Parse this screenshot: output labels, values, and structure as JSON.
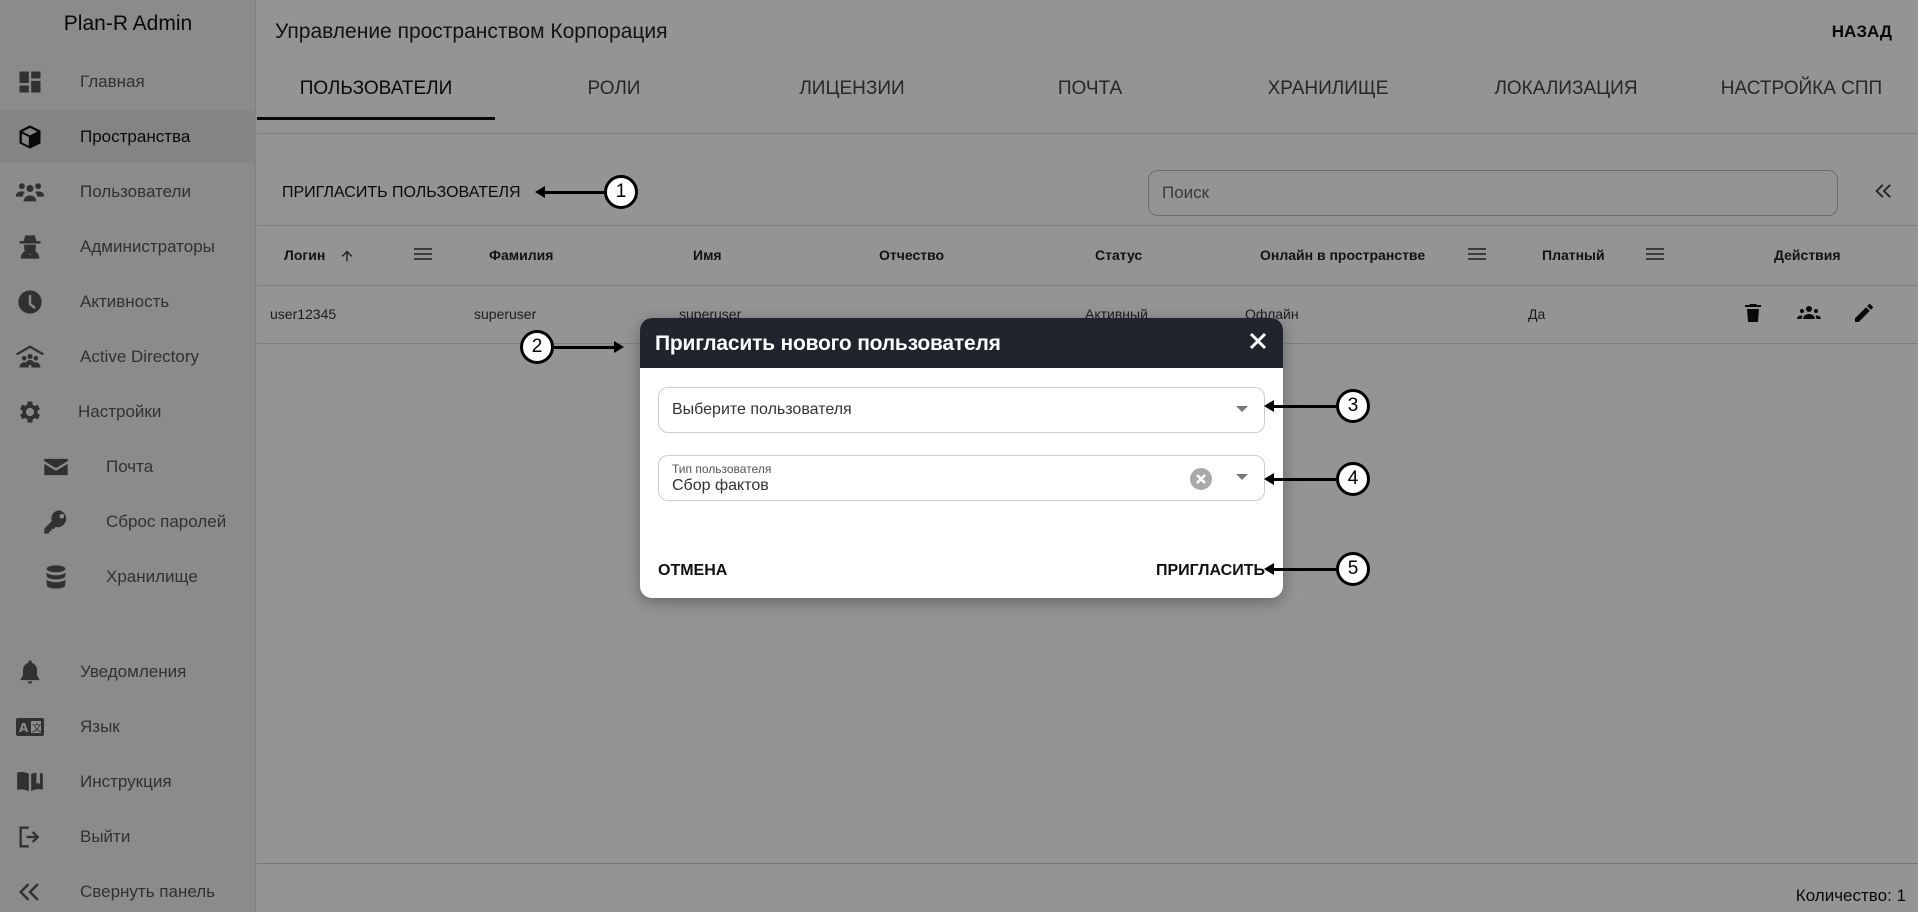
{
  "app": {
    "title": "Plan-R Admin"
  },
  "sidebar": {
    "items": [
      {
        "label": "Главная",
        "icon": "dashboard-icon"
      },
      {
        "label": "Пространства",
        "icon": "cube-icon",
        "active": true
      },
      {
        "label": "Пользователи",
        "icon": "users-icon"
      },
      {
        "label": "Администраторы",
        "icon": "spy-icon"
      },
      {
        "label": "Активность",
        "icon": "clock-icon"
      },
      {
        "label": "Active Directory",
        "icon": "house-users-icon"
      },
      {
        "label": "Настройки",
        "icon": "gear-icon"
      },
      {
        "label": "Почта",
        "icon": "envelope-icon",
        "sub": true
      },
      {
        "label": "Сброс паролей",
        "icon": "key-icon",
        "sub": true
      },
      {
        "label": "Хранилище",
        "icon": "database-icon",
        "sub": true
      },
      {
        "label": "Уведомления",
        "icon": "bell-icon"
      },
      {
        "label": "Язык",
        "icon": "language-icon"
      },
      {
        "label": "Инструкция",
        "icon": "book-icon"
      },
      {
        "label": "Выйти",
        "icon": "logout-icon"
      },
      {
        "label": "Свернуть панель",
        "icon": "double-chevron-left-icon"
      }
    ]
  },
  "header": {
    "title": "Управление пространством Корпорация",
    "back_label": "НАЗАД"
  },
  "tabs": [
    {
      "label": "ПОЛЬЗОВАТЕЛИ",
      "active": true
    },
    {
      "label": "РОЛИ"
    },
    {
      "label": "ЛИЦЕНЗИИ"
    },
    {
      "label": "ПОЧТА"
    },
    {
      "label": "ХРАНИЛИЩЕ"
    },
    {
      "label": "ЛОКАЛИЗАЦИЯ"
    },
    {
      "label": "НАСТРОЙКА СПП"
    }
  ],
  "toolbar": {
    "invite_label": "ПРИГЛАСИТЬ ПОЛЬЗОВАТЕЛЯ",
    "search_placeholder": "Поиск"
  },
  "table": {
    "columns": [
      "Логин",
      "Фамилия",
      "Имя",
      "Отчество",
      "Статус",
      "Онлайн в пространстве",
      "Платный",
      "Действия"
    ],
    "sort": {
      "column": "Логин",
      "direction": "asc"
    },
    "rows": [
      {
        "login": "user12345",
        "last_name": "superuser",
        "first_name": "superuser",
        "middle_name": "",
        "status": "Активный",
        "online": "Офлайн",
        "paid": "Да"
      }
    ]
  },
  "footer": {
    "count_label": "Количество: 1"
  },
  "modal": {
    "title": "Пригласить нового пользователя",
    "user_select_placeholder": "Выберите пользователя",
    "user_type_label": "Тип пользователя",
    "user_type_value": "Сбор фактов",
    "cancel_label": "ОТМЕНА",
    "invite_label": "ПРИГЛАСИТЬ"
  },
  "callouts": [
    "1",
    "2",
    "3",
    "4",
    "5"
  ]
}
